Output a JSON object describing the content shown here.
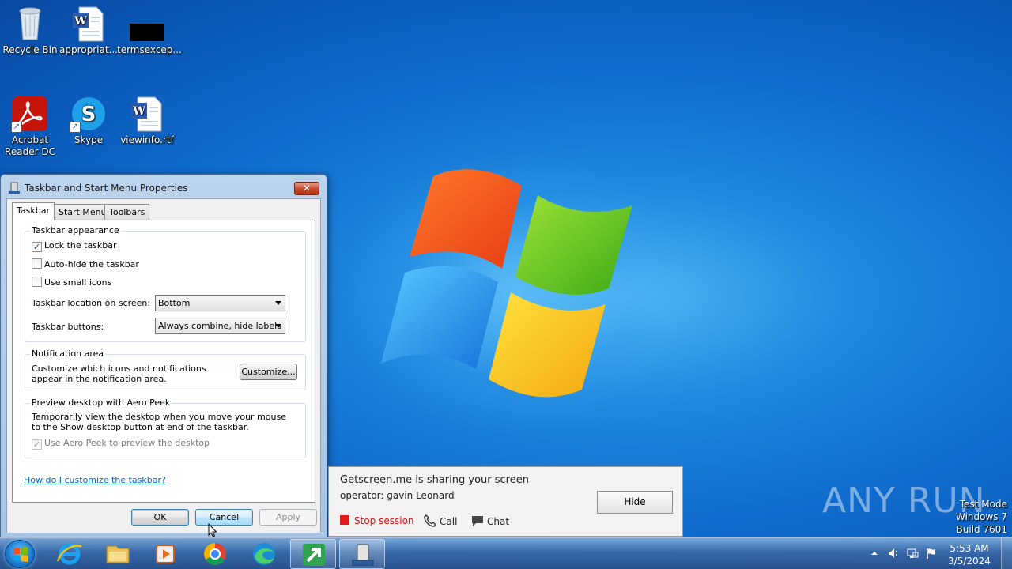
{
  "desktop": {
    "icons": [
      {
        "label": "Recycle Bin"
      },
      {
        "label": "appropriat..."
      },
      {
        "label": "termsexcep..."
      },
      {
        "label": "Acrobat Reader DC"
      },
      {
        "label": "Skype"
      },
      {
        "label": "viewinfo.rtf"
      }
    ]
  },
  "dialog": {
    "title": "Taskbar and Start Menu Properties",
    "close_label": "✕",
    "tabs": [
      {
        "label": "Taskbar",
        "active": true
      },
      {
        "label": "Start Menu",
        "active": false
      },
      {
        "label": "Toolbars",
        "active": false
      }
    ],
    "appearance": {
      "title": "Taskbar appearance",
      "lock_label": "Lock the taskbar",
      "lock_checked": true,
      "autohide_label": "Auto-hide the taskbar",
      "autohide_checked": false,
      "small_icons_label": "Use small icons",
      "small_icons_checked": false,
      "location_label": "Taskbar location on screen:",
      "location_value": "Bottom",
      "buttons_label": "Taskbar buttons:",
      "buttons_value": "Always combine, hide labels"
    },
    "notification": {
      "title": "Notification area",
      "text": "Customize which icons and notifications appear in the notification area.",
      "customize_label": "Customize..."
    },
    "aero_peek": {
      "title": "Preview desktop with Aero Peek",
      "text": "Temporarily view the desktop when you move your mouse to the Show desktop button at end of the taskbar.",
      "checkbox_label": "Use Aero Peek to preview the desktop",
      "checked": true,
      "disabled": true
    },
    "help_link": "How do I customize the taskbar?",
    "ok_label": "OK",
    "cancel_label": "Cancel",
    "apply_label": "Apply"
  },
  "getscreen": {
    "title": "Getscreen.me is sharing your screen",
    "operator": "operator: gavin Leonard",
    "hide_label": "Hide",
    "stop_label": "Stop session",
    "call_label": "Call",
    "chat_label": "Chat"
  },
  "watermark": {
    "text": "ANY RUN",
    "test_mode": "Test Mode",
    "os": "Windows 7",
    "build": "Build 7601"
  },
  "taskbar": {
    "apps": [
      {
        "icon": "internet-explorer-icon"
      },
      {
        "icon": "file-explorer-icon"
      },
      {
        "icon": "media-player-icon"
      },
      {
        "icon": "chrome-icon"
      },
      {
        "icon": "edge-icon"
      },
      {
        "icon": "getscreen-icon",
        "running": true
      },
      {
        "icon": "taskbar-properties-icon",
        "running": true,
        "active": true
      }
    ],
    "time": "5:53 AM",
    "date": "3/5/2024"
  }
}
